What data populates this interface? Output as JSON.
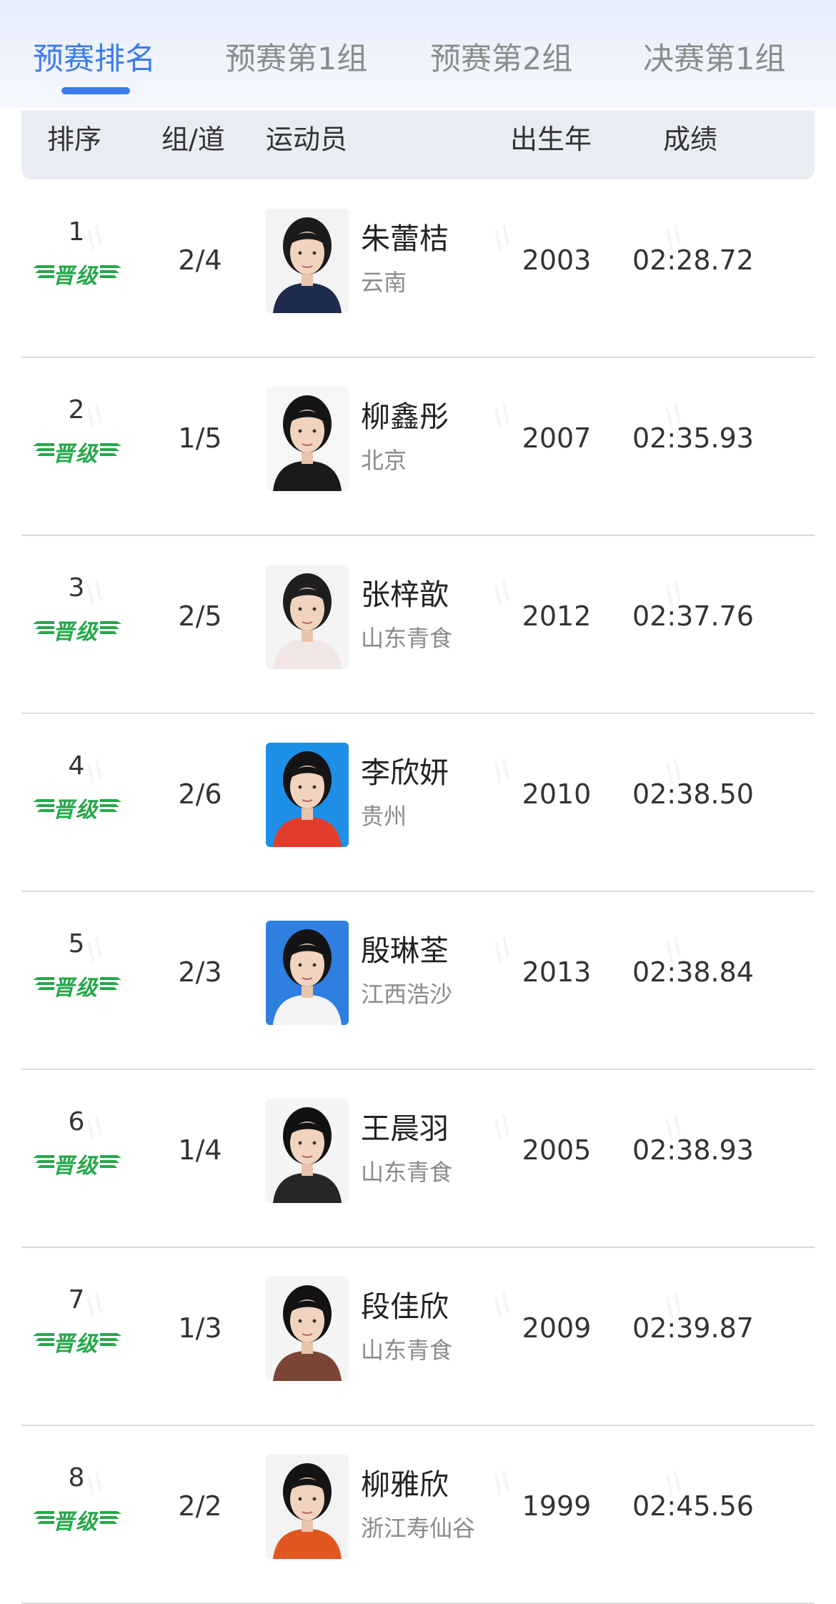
{
  "tabs": [
    "预赛排名",
    "预赛第1组",
    "预赛第2组",
    "决赛第1组"
  ],
  "columns": {
    "rank": "排序",
    "lane": "组/道",
    "athlete": "运动员",
    "birth_year": "出生年",
    "result": "成绩"
  },
  "badge_label": "晋级",
  "colors": {
    "accent": "#3b7bea",
    "qualify_green": "#24a84a"
  },
  "rows": [
    {
      "rank": "1",
      "lane": "2/4",
      "name": "朱蕾桔",
      "team": "云南",
      "year": "2003",
      "result": "02:28.72"
    },
    {
      "rank": "2",
      "lane": "1/5",
      "name": "柳鑫彤",
      "team": "北京",
      "year": "2007",
      "result": "02:35.93"
    },
    {
      "rank": "3",
      "lane": "2/5",
      "name": "张梓歆",
      "team": "山东青食",
      "year": "2012",
      "result": "02:37.76"
    },
    {
      "rank": "4",
      "lane": "2/6",
      "name": "李欣妍",
      "team": "贵州",
      "year": "2010",
      "result": "02:38.50"
    },
    {
      "rank": "5",
      "lane": "2/3",
      "name": "殷琳荃",
      "team": "江西浩沙",
      "year": "2013",
      "result": "02:38.84"
    },
    {
      "rank": "6",
      "lane": "1/4",
      "name": "王晨羽",
      "team": "山东青食",
      "year": "2005",
      "result": "02:38.93"
    },
    {
      "rank": "7",
      "lane": "1/3",
      "name": "段佳欣",
      "team": "山东青食",
      "year": "2009",
      "result": "02:39.87"
    },
    {
      "rank": "8",
      "lane": "2/2",
      "name": "柳雅欣",
      "team": "浙江寿仙谷",
      "year": "1999",
      "result": "02:45.56"
    }
  ]
}
